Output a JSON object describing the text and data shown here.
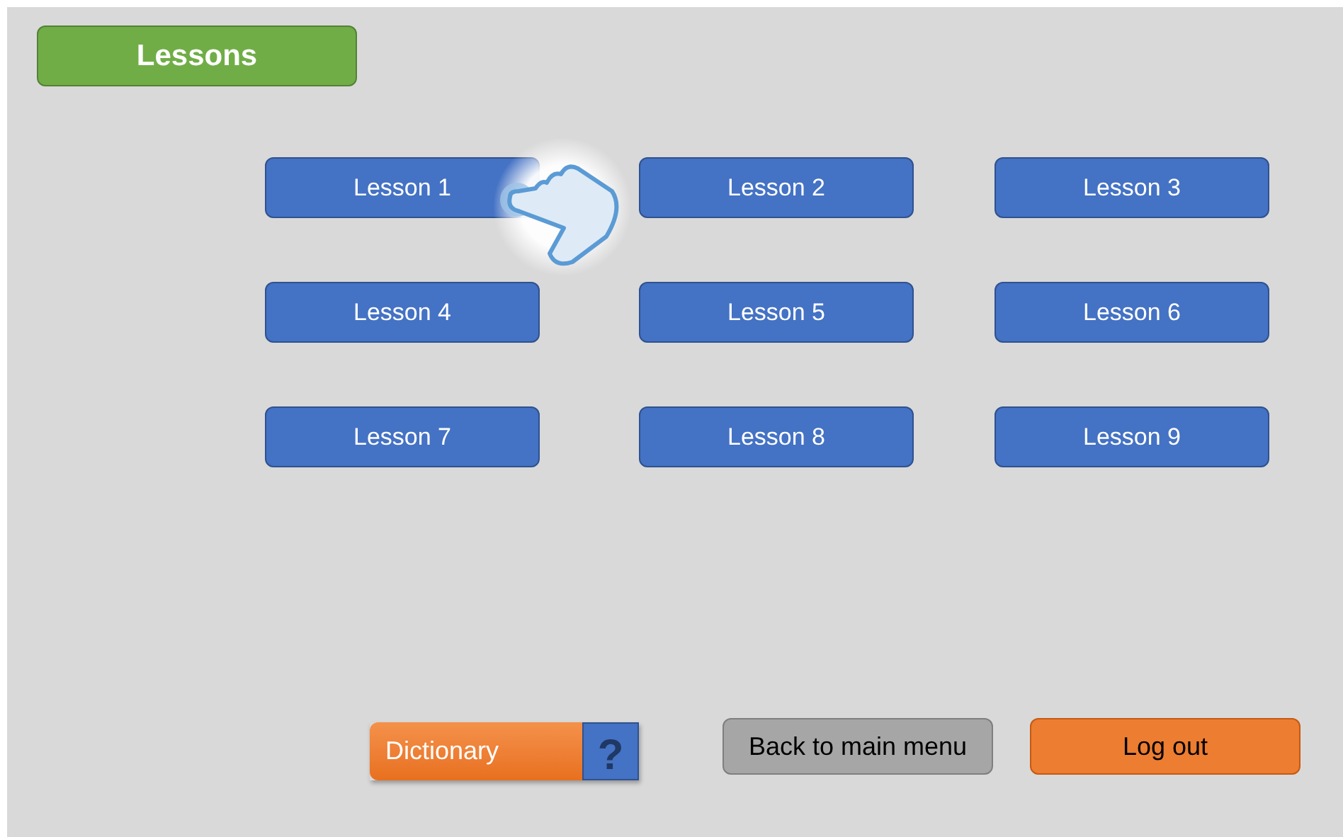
{
  "header": {
    "title": "Lessons"
  },
  "lessons": [
    {
      "label": "Lesson 1"
    },
    {
      "label": "Lesson 2"
    },
    {
      "label": "Lesson 3"
    },
    {
      "label": "Lesson 4"
    },
    {
      "label": "Lesson 5"
    },
    {
      "label": "Lesson 6"
    },
    {
      "label": "Lesson 7"
    },
    {
      "label": "Lesson 8"
    },
    {
      "label": "Lesson 9"
    }
  ],
  "footer": {
    "dictionary": "Dictionary",
    "help": "?",
    "back": "Back to main menu",
    "logout": "Log out"
  }
}
